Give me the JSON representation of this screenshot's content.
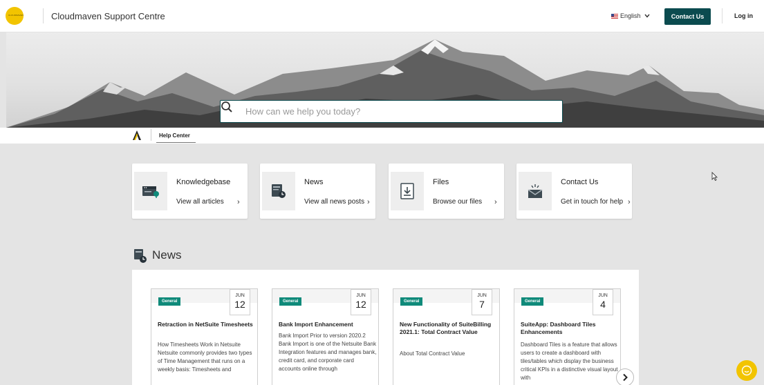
{
  "header": {
    "logo_text": "CLOUDMAVEN",
    "site_title": "Cloudmaven Support Centre",
    "language": "English",
    "contact_label": "Contact Us",
    "login_label": "Log in"
  },
  "hero": {
    "search_placeholder": "How can we help you today?"
  },
  "breadcrumb": {
    "label": "Help Center"
  },
  "quick_links": [
    {
      "title": "Knowledgebase",
      "link": "View all articles",
      "arrow": "›",
      "icon": "knowledgebase-icon"
    },
    {
      "title": "News",
      "link": "View all news posts",
      "arrow": "›",
      "icon": "news-icon"
    },
    {
      "title": "Files",
      "link": "Browse our files",
      "arrow": "›",
      "icon": "download-file-icon"
    },
    {
      "title": "Contact Us",
      "link": "Get in touch for help",
      "arrow": "›",
      "icon": "envelope-icon"
    }
  ],
  "news": {
    "heading": "News",
    "posts": [
      {
        "badge": "General",
        "month": "JUN",
        "day": "12",
        "title": "Retraction in NetSuite Timesheets",
        "excerpt": "How Timesheets Work in Netsuite Netsuite commonly provides two types of Time Management that runs on a weekly basis: Timesheets and"
      },
      {
        "badge": "General",
        "month": "JUN",
        "day": "12",
        "title": "Bank Import Enhancement",
        "excerpt": "Bank Import Prior to version 2020.2 Bank Import is one of the Netsuite Bank Integration features and manages bank, credit card, and corporate card accounts online through"
      },
      {
        "badge": "General",
        "month": "JUN",
        "day": "7",
        "title": "New Functionality of SuiteBilling 2021.1: Total Contract Value",
        "excerpt": "About Total Contract Value"
      },
      {
        "badge": "General",
        "month": "JUN",
        "day": "4",
        "title": "SuiteApp: Dashboard Tiles Enhancements",
        "excerpt": "Dashboard Tiles is a feature that allows users to create a dashboard with tiles/tables which display the business critical KPIs in a distinctive visual layout with"
      }
    ]
  },
  "colors": {
    "brand_teal": "#0b4b4f",
    "badge_green": "#0f8a7a",
    "logo_yellow": "#f2c400"
  }
}
